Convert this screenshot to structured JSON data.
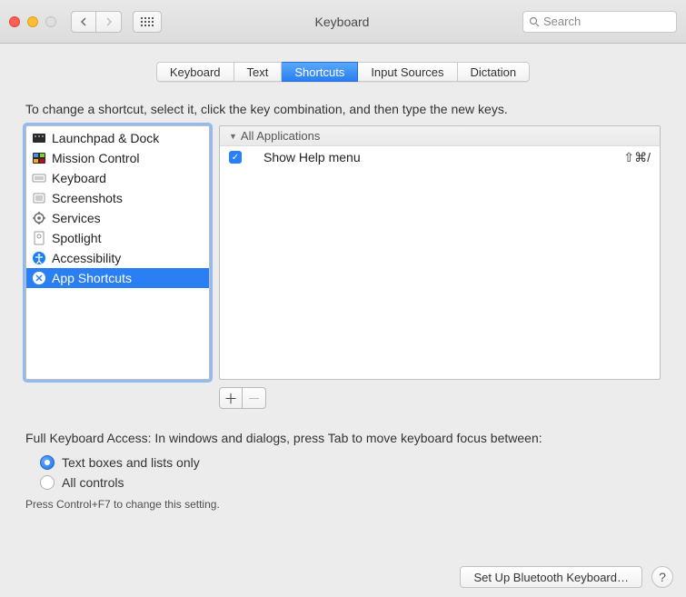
{
  "window": {
    "title": "Keyboard"
  },
  "search": {
    "placeholder": "Search"
  },
  "tabs": [
    {
      "label": "Keyboard"
    },
    {
      "label": "Text"
    },
    {
      "label": "Shortcuts",
      "selected": true
    },
    {
      "label": "Input Sources"
    },
    {
      "label": "Dictation"
    }
  ],
  "instructions": "To change a shortcut, select it, click the key combination, and then type the new keys.",
  "categories": [
    {
      "label": "Launchpad & Dock",
      "icon": "launchpad"
    },
    {
      "label": "Mission Control",
      "icon": "mission"
    },
    {
      "label": "Keyboard",
      "icon": "keyboard"
    },
    {
      "label": "Screenshots",
      "icon": "screenshot"
    },
    {
      "label": "Services",
      "icon": "gear"
    },
    {
      "label": "Spotlight",
      "icon": "spotlight"
    },
    {
      "label": "Accessibility",
      "icon": "accessibility"
    },
    {
      "label": "App Shortcuts",
      "icon": "appstore",
      "selected": true
    }
  ],
  "group_header": "All Applications",
  "shortcuts": [
    {
      "checked": true,
      "label": "Show Help menu",
      "keys": "⇧⌘/"
    }
  ],
  "full_keyboard_access": {
    "label": "Full Keyboard Access: In windows and dialogs, press Tab to move keyboard focus between:",
    "options": [
      {
        "label": "Text boxes and lists only",
        "selected": true
      },
      {
        "label": "All controls"
      }
    ],
    "hint": "Press Control+F7 to change this setting."
  },
  "footer": {
    "bluetooth": "Set Up Bluetooth Keyboard…"
  }
}
